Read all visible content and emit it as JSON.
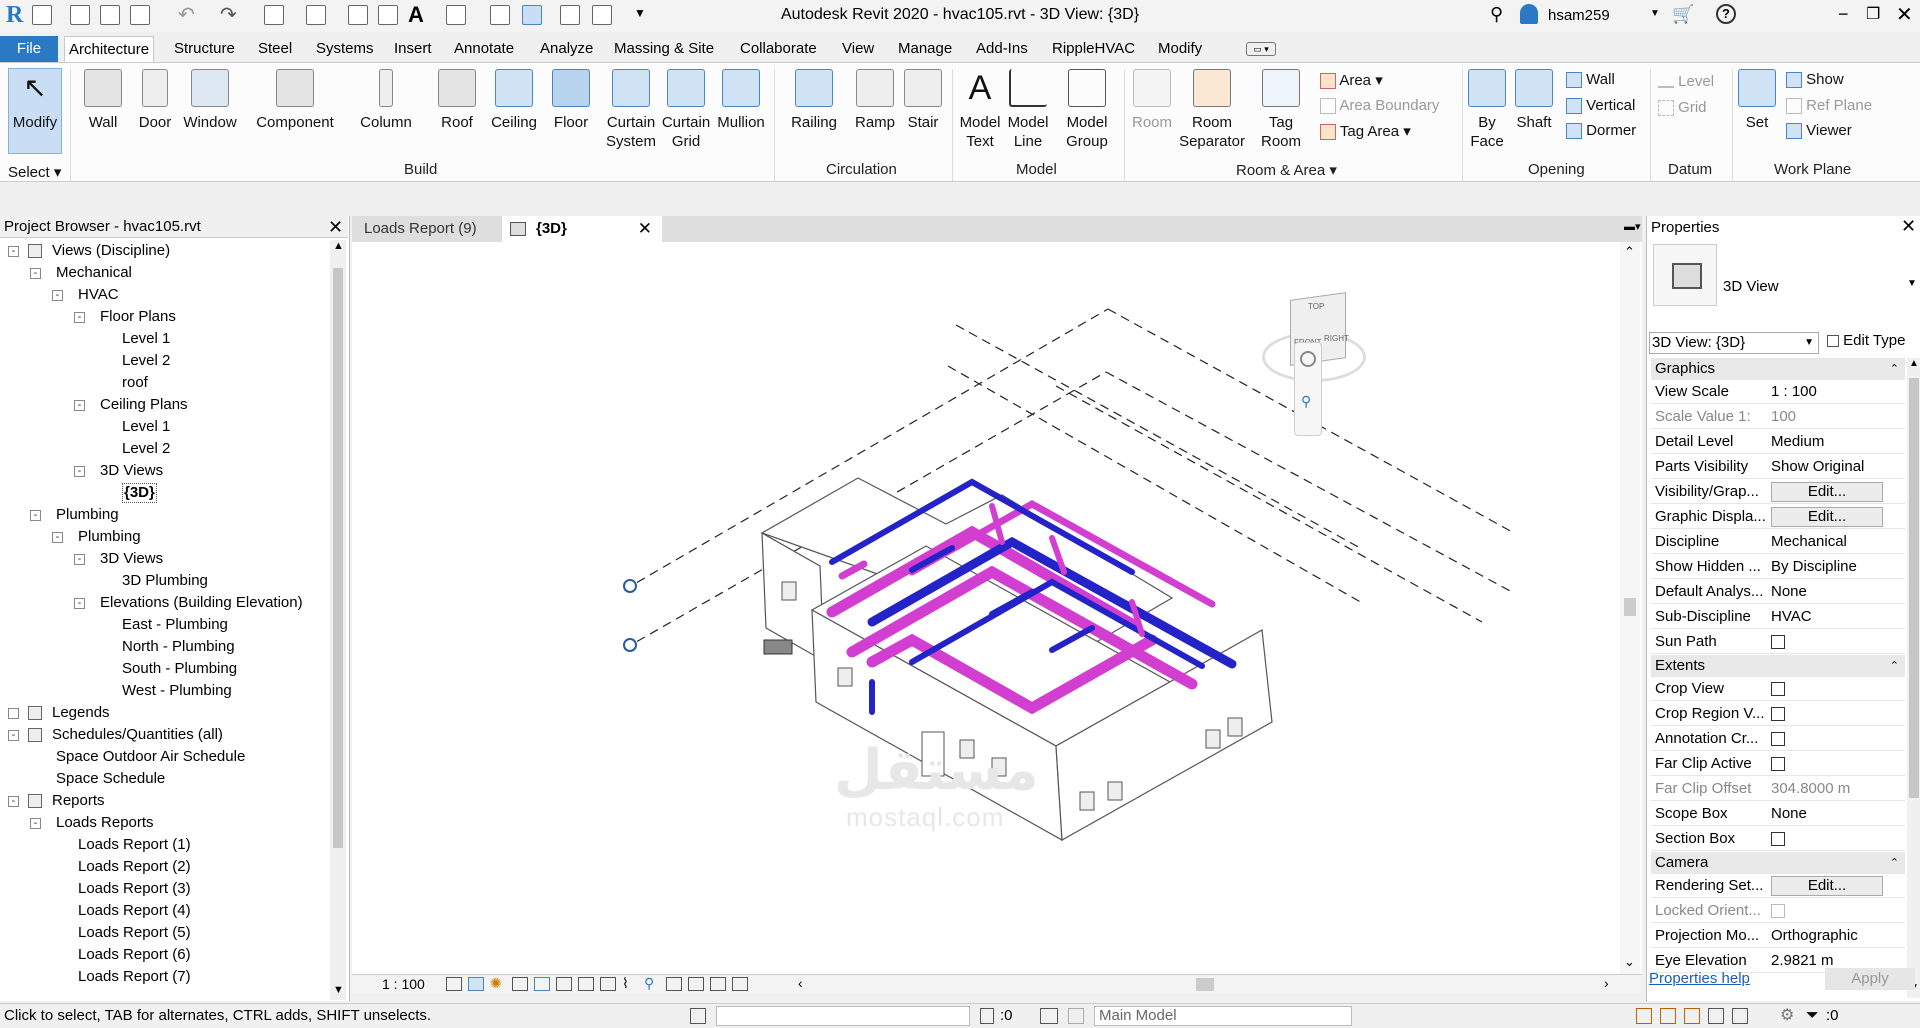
{
  "app": {
    "title": "Autodesk Revit 2020 - hvac105.rvt - 3D View: {3D}",
    "user": "hsam259"
  },
  "colors": {
    "accent": "#2b78c5",
    "duct_magenta": "#d23fd0",
    "duct_blue": "#2323c8"
  },
  "tabs": [
    "File",
    "Architecture",
    "Structure",
    "Steel",
    "Systems",
    "Insert",
    "Annotate",
    "Analyze",
    "Massing & Site",
    "Collaborate",
    "View",
    "Manage",
    "Add-Ins",
    "RippleHVAC",
    "Modify"
  ],
  "ribbon": {
    "select": {
      "modify": "Modify",
      "select": "Select"
    },
    "build": {
      "label": "Build",
      "buttons": [
        "Wall",
        "Door",
        "Window",
        "Component",
        "Column",
        "Roof",
        "Ceiling",
        "Floor",
        "Curtain\nSystem",
        "Curtain\nGrid",
        "Mullion"
      ]
    },
    "circulation": {
      "label": "Circulation",
      "buttons": [
        "Railing",
        "Ramp",
        "Stair"
      ]
    },
    "model": {
      "label": "Model",
      "buttons": [
        "Model\nText",
        "Model\nLine",
        "Model\nGroup"
      ]
    },
    "room_area": {
      "label": "Room & Area",
      "room": "Room",
      "room_sep": "Room\nSeparator",
      "tag_room": "Tag\nRoom",
      "area": "Area",
      "area_boundary": "Area  Boundary",
      "tag_area": "Tag   Area"
    },
    "opening": {
      "label": "Opening",
      "by_face": "By\nFace",
      "shaft": "Shaft",
      "wall": "Wall",
      "vertical": "Vertical",
      "dormer": "Dormer"
    },
    "datum": {
      "label": "Datum",
      "level": "Level",
      "grid": "Grid"
    },
    "workplane": {
      "label": "Work Plane",
      "set": "Set",
      "show": "Show",
      "ref_plane": "Ref  Plane",
      "viewer": "Viewer"
    }
  },
  "browser": {
    "title": "Project Browser - hvac105.rvt",
    "items": [
      {
        "t": "Views (Discipline)",
        "d": 0,
        "tog": "-"
      },
      {
        "t": "Mechanical",
        "d": 1,
        "tog": "-"
      },
      {
        "t": "HVAC",
        "d": 2,
        "tog": "-"
      },
      {
        "t": "Floor Plans",
        "d": 3,
        "tog": "-"
      },
      {
        "t": "Level 1",
        "d": 4
      },
      {
        "t": "Level 2",
        "d": 4
      },
      {
        "t": "roof",
        "d": 4
      },
      {
        "t": "Ceiling Plans",
        "d": 3,
        "tog": "-"
      },
      {
        "t": "Level 1",
        "d": 4
      },
      {
        "t": "Level 2",
        "d": 4
      },
      {
        "t": "3D Views",
        "d": 3,
        "tog": "-"
      },
      {
        "t": "{3D}",
        "d": 4,
        "bold": true
      },
      {
        "t": "Plumbing",
        "d": 1,
        "tog": "-"
      },
      {
        "t": "Plumbing",
        "d": 2,
        "tog": "-"
      },
      {
        "t": "3D Views",
        "d": 3,
        "tog": "-"
      },
      {
        "t": "3D Plumbing",
        "d": 4
      },
      {
        "t": "Elevations (Building Elevation)",
        "d": 3,
        "tog": "-"
      },
      {
        "t": "East - Plumbing",
        "d": 4
      },
      {
        "t": "North - Plumbing",
        "d": 4
      },
      {
        "t": "South - Plumbing",
        "d": 4
      },
      {
        "t": "West - Plumbing",
        "d": 4
      },
      {
        "t": "Legends",
        "d": 0,
        "tog": ""
      },
      {
        "t": "Schedules/Quantities (all)",
        "d": 0,
        "tog": "-"
      },
      {
        "t": "Space Outdoor Air Schedule",
        "d": 1
      },
      {
        "t": "Space Schedule",
        "d": 1
      },
      {
        "t": "Reports",
        "d": 0,
        "tog": "-"
      },
      {
        "t": "Loads Reports",
        "d": 1,
        "tog": "-"
      },
      {
        "t": "Loads Report (1)",
        "d": 2
      },
      {
        "t": "Loads Report (2)",
        "d": 2
      },
      {
        "t": "Loads Report (3)",
        "d": 2
      },
      {
        "t": "Loads Report (4)",
        "d": 2
      },
      {
        "t": "Loads Report (5)",
        "d": 2
      },
      {
        "t": "Loads Report (6)",
        "d": 2
      },
      {
        "t": "Loads Report (7)",
        "d": 2
      }
    ]
  },
  "view_tabs": [
    "Loads Report (9)",
    "{3D}"
  ],
  "viewport": {
    "scale": "1 : 100",
    "watermark1": "مستقل",
    "watermark2": "mostaql.com",
    "cube_top": "TOP",
    "cube_front": "FRONT",
    "cube_right": "RIGHT"
  },
  "properties": {
    "title": "Properties",
    "type": "3D View",
    "selector": "3D View: {3D}",
    "edit_type": "Edit Type",
    "sections": [
      {
        "name": "Graphics",
        "rows": [
          [
            "View Scale",
            "1 : 100"
          ],
          [
            "Scale Value    1:",
            "100",
            "dis"
          ],
          [
            "Detail Level",
            "Medium"
          ],
          [
            "Parts Visibility",
            "Show Original"
          ],
          [
            "Visibility/Grap...",
            "Edit...",
            "btn"
          ],
          [
            "Graphic Displa...",
            "Edit...",
            "btn"
          ],
          [
            "Discipline",
            "Mechanical"
          ],
          [
            "Show Hidden ...",
            "By Discipline"
          ],
          [
            "Default Analys...",
            "None"
          ],
          [
            "Sub-Discipline",
            "HVAC"
          ],
          [
            "Sun Path",
            "",
            "chk"
          ]
        ]
      },
      {
        "name": "Extents",
        "rows": [
          [
            "Crop View",
            "",
            "chk"
          ],
          [
            "Crop Region V...",
            "",
            "chk"
          ],
          [
            "Annotation Cr...",
            "",
            "chk"
          ],
          [
            "Far Clip Active",
            "",
            "chk"
          ],
          [
            "Far Clip Offset",
            "304.8000 m",
            "dis"
          ],
          [
            "Scope Box",
            "None"
          ],
          [
            "Section Box",
            "",
            "chk"
          ]
        ]
      },
      {
        "name": "Camera",
        "rows": [
          [
            "Rendering Set...",
            "Edit...",
            "btn"
          ],
          [
            "Locked Orient...",
            "",
            "chkdis"
          ],
          [
            "Projection Mo...",
            "Orthographic"
          ],
          [
            "Eye Elevation",
            "2.9821 m"
          ]
        ]
      }
    ],
    "help": "Properties help",
    "apply": "Apply"
  },
  "status": {
    "text": "Click to select, TAB for alternates, CTRL adds, SHIFT unselects.",
    "count1": ":0",
    "model": "Main Model",
    "filter": ":0"
  }
}
